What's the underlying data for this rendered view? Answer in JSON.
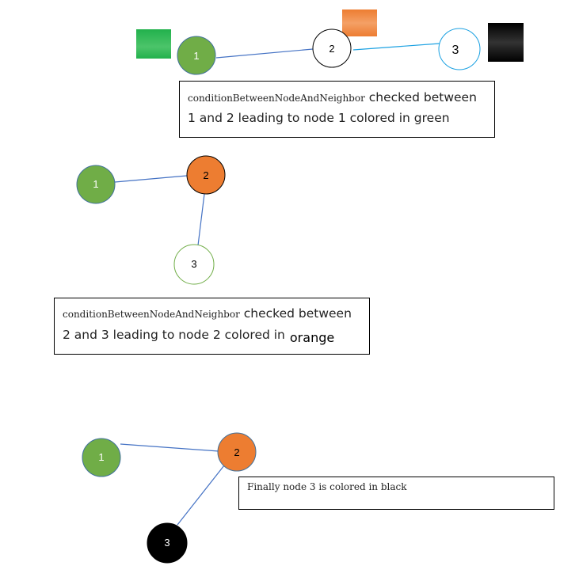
{
  "colors": {
    "green": "#70ad47",
    "orange": "#ed7d31",
    "black": "#000000",
    "edge": "#4472c4",
    "edge_light": "#1ba1e2"
  },
  "panel1": {
    "nodes": [
      {
        "label": "1",
        "fill": "green"
      },
      {
        "label": "2",
        "fill": "white"
      },
      {
        "label": "3",
        "fill": "white"
      }
    ],
    "caption": {
      "code": "conditionBetweenNodeAndNeighbor",
      "text": " checked between 1 and 2 leading to node 1 colored in green"
    }
  },
  "panel2": {
    "nodes": [
      {
        "label": "1",
        "fill": "green"
      },
      {
        "label": "2",
        "fill": "orange"
      },
      {
        "label": "3",
        "fill": "white"
      }
    ],
    "caption": {
      "code": "conditionBetweenNodeAndNeighbor",
      "text": " checked between 2 and 3 leading to node 2 colored in",
      "highlight": "orange"
    }
  },
  "panel3": {
    "nodes": [
      {
        "label": "1",
        "fill": "green"
      },
      {
        "label": "2",
        "fill": "orange"
      },
      {
        "label": "3",
        "fill": "black"
      }
    ],
    "caption": {
      "text": "Finally node 3 is colored in black"
    }
  }
}
